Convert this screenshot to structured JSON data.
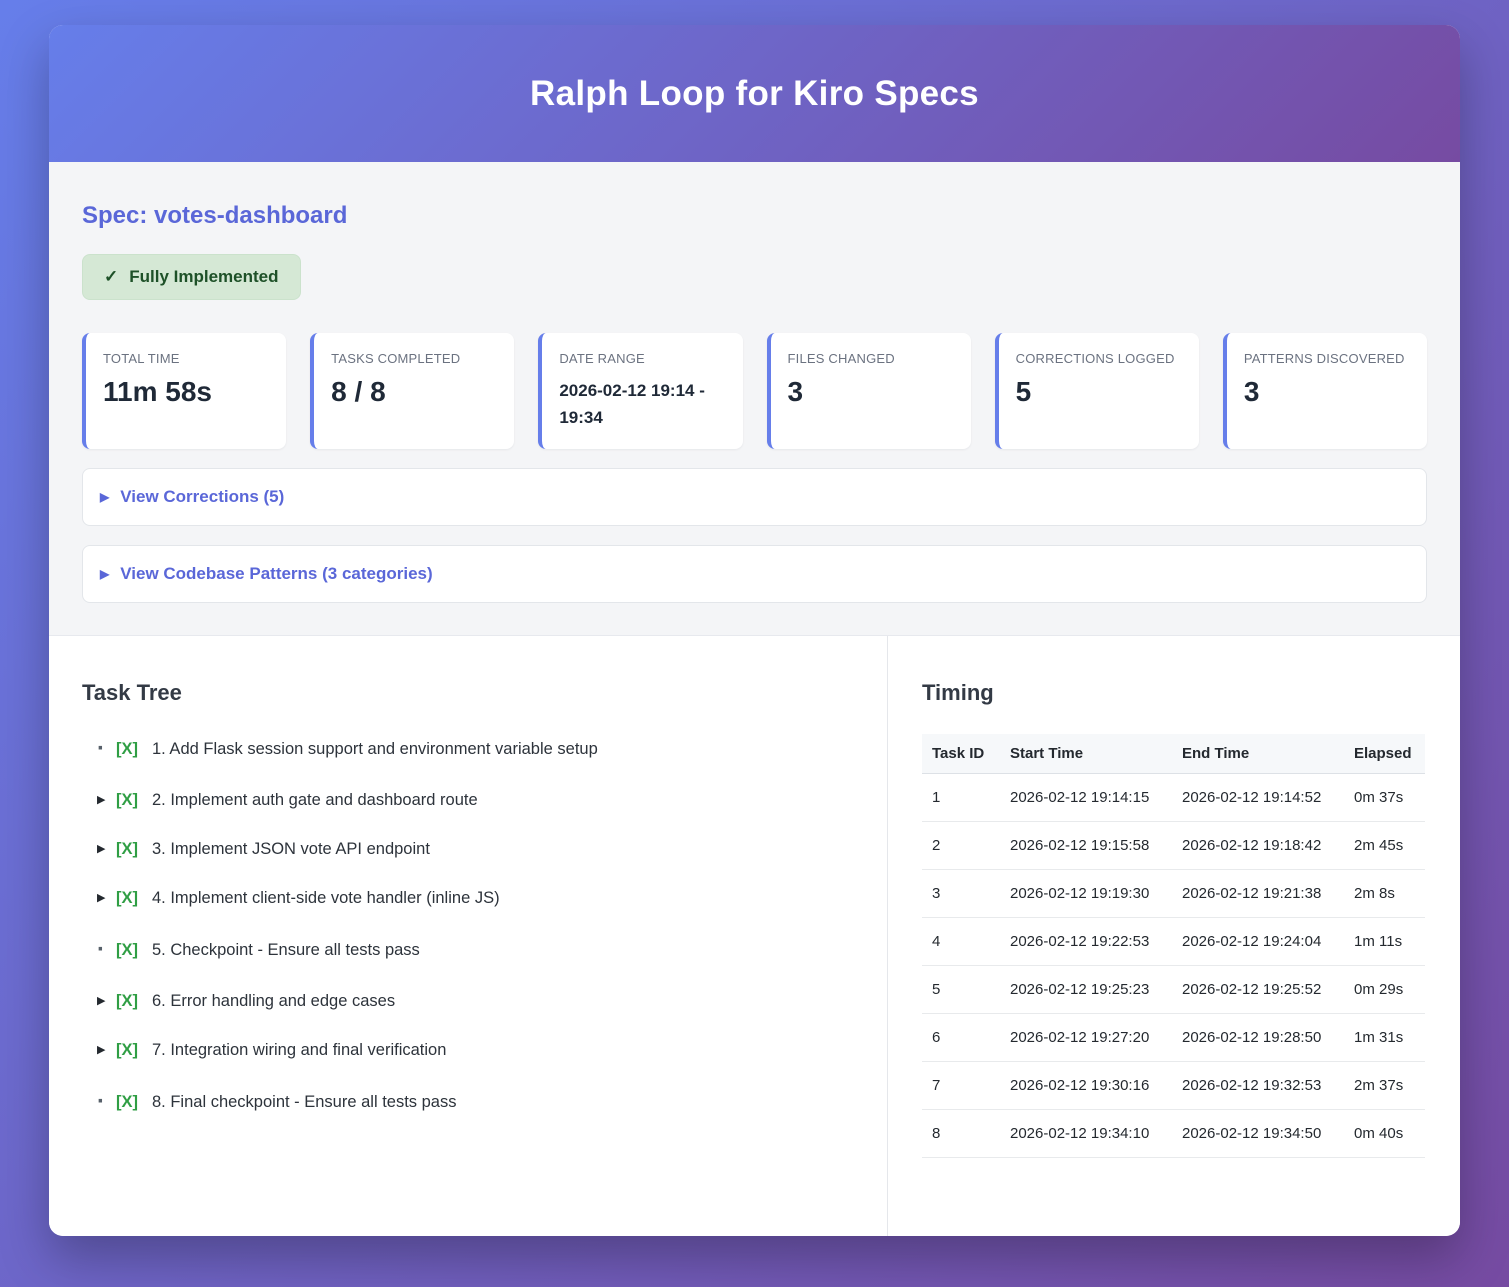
{
  "header": {
    "title": "Ralph Loop for Kiro Specs"
  },
  "spec": {
    "heading": "Spec: votes-dashboard",
    "badge_icon": "✓",
    "badge_label": "Fully Implemented"
  },
  "stats": [
    {
      "label": "TOTAL TIME",
      "value": "11m 58s"
    },
    {
      "label": "TASKS COMPLETED",
      "value": "8 / 8"
    },
    {
      "label": "DATE RANGE",
      "value": "2026-02-12 19:14 - 19:34"
    },
    {
      "label": "FILES CHANGED",
      "value": "3"
    },
    {
      "label": "CORRECTIONS LOGGED",
      "value": "5"
    },
    {
      "label": "PATTERNS DISCOVERED",
      "value": "3"
    }
  ],
  "collapsibles": [
    {
      "marker": "▶",
      "label": "View Corrections (5)"
    },
    {
      "marker": "▶",
      "label": "View Codebase Patterns (3 categories)"
    }
  ],
  "task_tree": {
    "heading": "Task Tree",
    "items": [
      {
        "marker": "·",
        "checkbox": "[X]",
        "label": "1. Add Flask session support and environment variable setup"
      },
      {
        "marker": "▶",
        "checkbox": "[X]",
        "label": "2. Implement auth gate and dashboard route"
      },
      {
        "marker": "▶",
        "checkbox": "[X]",
        "label": "3. Implement JSON vote API endpoint"
      },
      {
        "marker": "▶",
        "checkbox": "[X]",
        "label": "4. Implement client-side vote handler (inline JS)"
      },
      {
        "marker": "·",
        "checkbox": "[X]",
        "label": "5. Checkpoint - Ensure all tests pass"
      },
      {
        "marker": "▶",
        "checkbox": "[X]",
        "label": "6. Error handling and edge cases"
      },
      {
        "marker": "▶",
        "checkbox": "[X]",
        "label": "7. Integration wiring and final verification"
      },
      {
        "marker": "·",
        "checkbox": "[X]",
        "label": "8. Final checkpoint - Ensure all tests pass"
      }
    ]
  },
  "timing": {
    "heading": "Timing",
    "columns": [
      "Task ID",
      "Start Time",
      "End Time",
      "Elapsed"
    ],
    "rows": [
      [
        "1",
        "2026-02-12 19:14:15",
        "2026-02-12 19:14:52",
        "0m 37s"
      ],
      [
        "2",
        "2026-02-12 19:15:58",
        "2026-02-12 19:18:42",
        "2m 45s"
      ],
      [
        "3",
        "2026-02-12 19:19:30",
        "2026-02-12 19:21:38",
        "2m 8s"
      ],
      [
        "4",
        "2026-02-12 19:22:53",
        "2026-02-12 19:24:04",
        "1m 11s"
      ],
      [
        "5",
        "2026-02-12 19:25:23",
        "2026-02-12 19:25:52",
        "0m 29s"
      ],
      [
        "6",
        "2026-02-12 19:27:20",
        "2026-02-12 19:28:50",
        "1m 31s"
      ],
      [
        "7",
        "2026-02-12 19:30:16",
        "2026-02-12 19:32:53",
        "2m 37s"
      ],
      [
        "8",
        "2026-02-12 19:34:10",
        "2026-02-12 19:34:50",
        "0m 40s"
      ]
    ]
  },
  "colors": {
    "accent_indigo": "#5a67d8",
    "card_border_indigo": "#667eea",
    "gradient_start": "#667eea",
    "gradient_end": "#764ba2",
    "badge_bg_green": "#d5e8d5",
    "badge_text_green": "#1e5128",
    "checkbox_green": "#2f9e44",
    "summary_bg": "#f4f5f7"
  }
}
